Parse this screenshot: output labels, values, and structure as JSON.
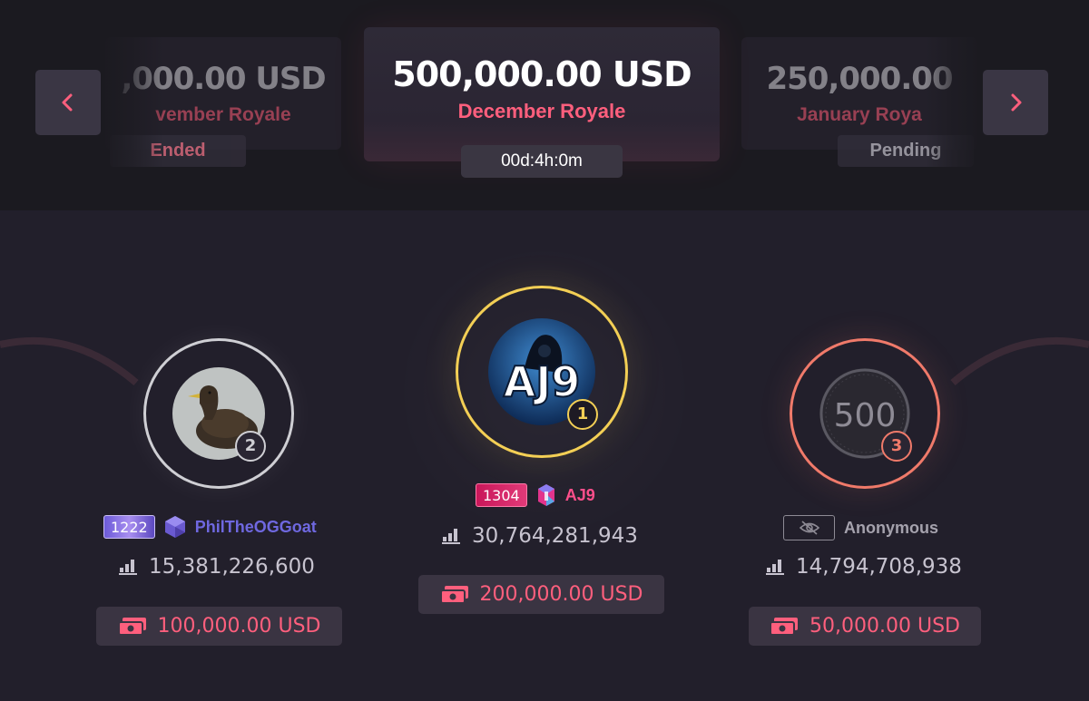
{
  "carousel": {
    "prev": {
      "amount": ",000.00 USD",
      "name": "vember Royale",
      "status": "Ended"
    },
    "current": {
      "amount": "500,000.00 USD",
      "name": "December Royale",
      "timer": "00d:4h:0m"
    },
    "next": {
      "amount": "250,000.00",
      "name": "January Roya",
      "status": "Pending"
    }
  },
  "podium": {
    "second": {
      "rank": "2",
      "level": "1222",
      "username": "PhilTheOGGoat",
      "wagered": "15,381,226,600",
      "prize": "100,000.00 USD"
    },
    "first": {
      "rank": "1",
      "level": "1304",
      "username": "AJ9",
      "avatar_text": "AJ9",
      "wagered": "30,764,281,943",
      "prize": "200,000.00 USD"
    },
    "third": {
      "rank": "3",
      "username": "Anonymous",
      "avatar_text": "500",
      "wagered": "14,794,708,938",
      "prize": "50,000.00 USD"
    }
  },
  "colors": {
    "accent": "#ff5f7d",
    "gold": "#f3cf55",
    "silver": "#cfcfd4",
    "bronze": "#f07a6a",
    "background": "#221f2b"
  },
  "icons": [
    "chevron-left-icon",
    "chevron-right-icon",
    "gem-icon",
    "crystal-icon",
    "hidden-eye-icon",
    "bar-chart-icon",
    "cash-stack-icon"
  ]
}
